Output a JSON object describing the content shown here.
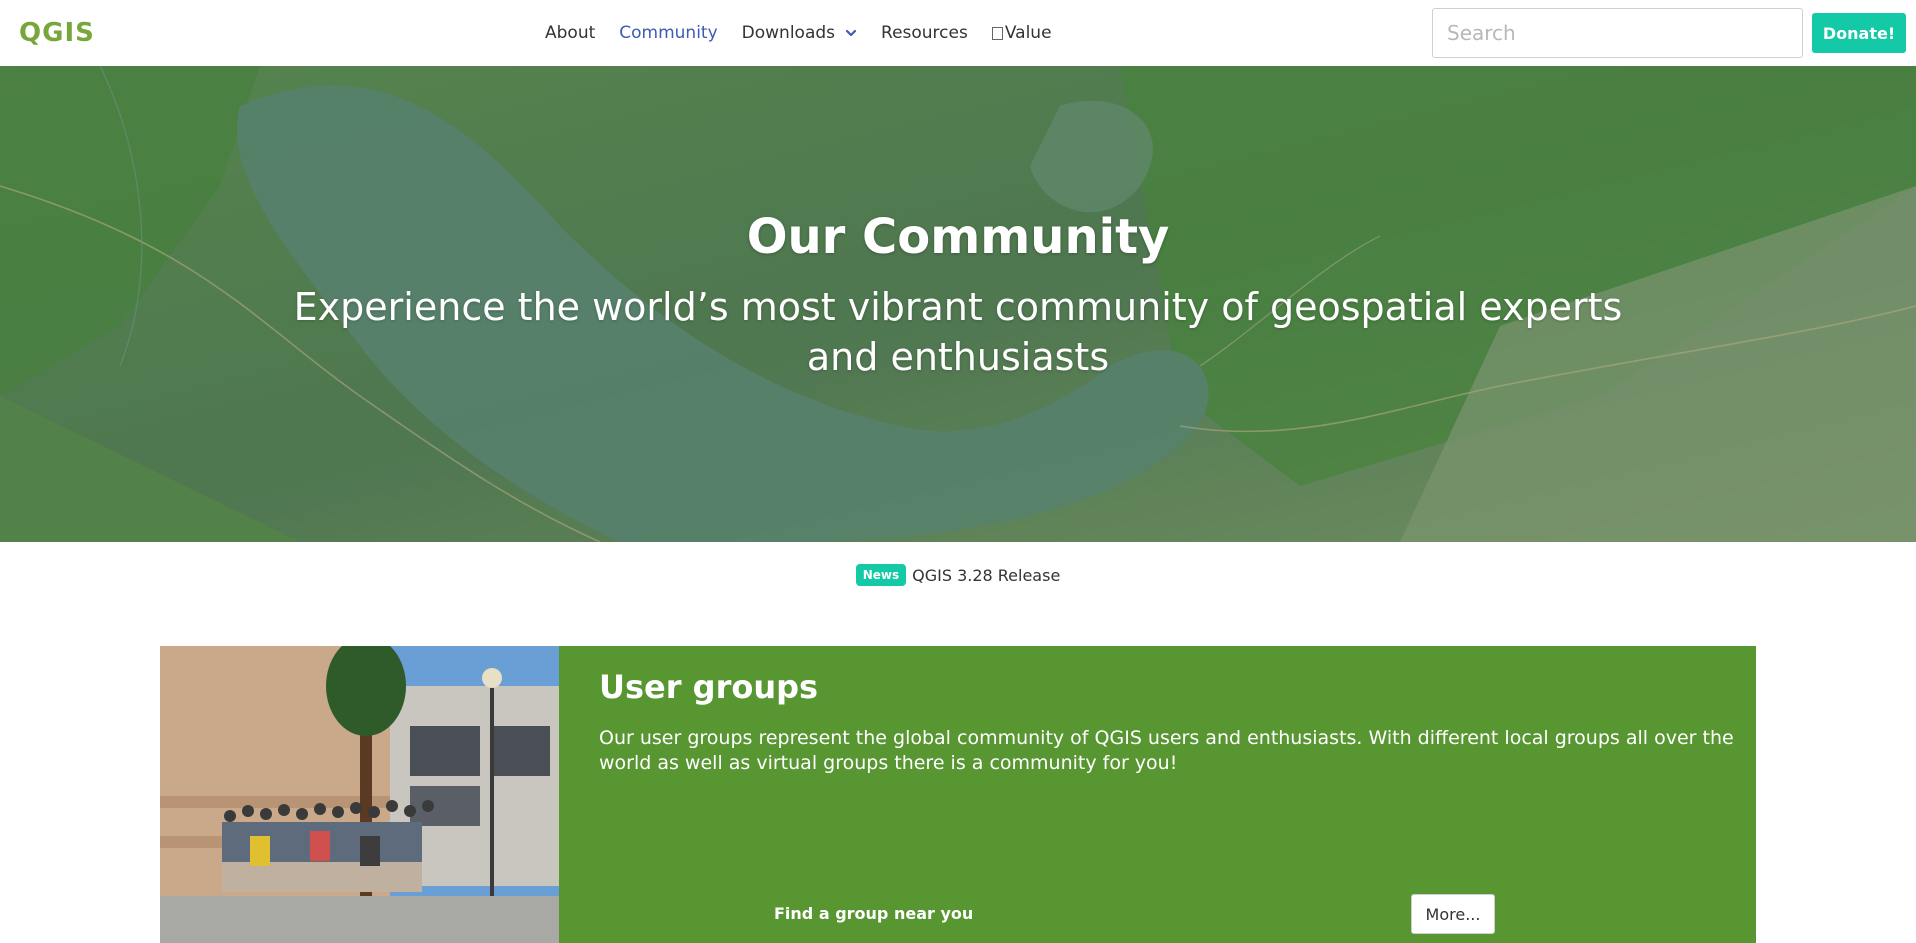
{
  "brand": {
    "logo_text": "QGIS",
    "logo_color": "#77a63a"
  },
  "nav": {
    "items": [
      {
        "label": "About",
        "active": false
      },
      {
        "label": "Community",
        "active": true
      },
      {
        "label": "Downloads",
        "active": false,
        "dropdown": true
      },
      {
        "label": "Resources",
        "active": false
      },
      {
        "label": "Value",
        "active": false,
        "icon": "broken-image-icon"
      }
    ],
    "active_color": "#3d5bb3"
  },
  "search": {
    "placeholder": "Search",
    "value": ""
  },
  "donate": {
    "label": "Donate!",
    "color": "#14c9a5"
  },
  "hero": {
    "title": "Our Community",
    "subtitle": "Experience the world’s most vibrant community of geospatial experts and enthusiasts"
  },
  "news": {
    "badge": "News",
    "link": "QGIS 3.28 Release"
  },
  "user_groups": {
    "title": "User groups",
    "description": "Our user groups represent the global community of QGIS users and enthusiasts. With different local groups all over the world as well as virtual groups there is a community for you!",
    "find_label": "Find a group near you",
    "more_label": "More...",
    "background_color": "#589632"
  }
}
